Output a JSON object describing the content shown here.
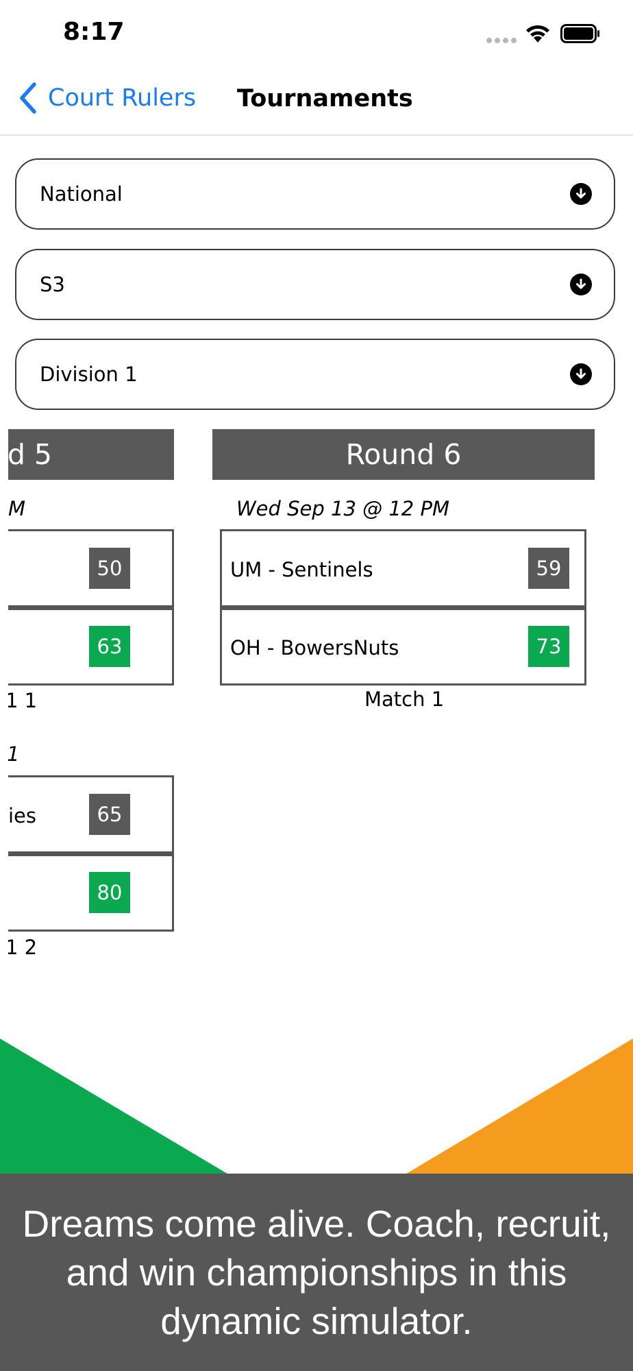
{
  "status_bar": {
    "time": "8:17"
  },
  "nav": {
    "back_label": "Court Rulers",
    "title": "Tournaments"
  },
  "selectors": [
    {
      "label": "National"
    },
    {
      "label": "S3"
    },
    {
      "label": "Division 1"
    }
  ],
  "bracket": {
    "round5": {
      "title": "d 5",
      "matches": [
        {
          "date": "M",
          "teams": [
            {
              "name": "",
              "score": "50",
              "winner": false
            },
            {
              "name": "",
              "score": "63",
              "winner": true
            }
          ],
          "label": "1 1"
        },
        {
          "date": "1",
          "teams": [
            {
              "name": "ies",
              "score": "65",
              "winner": false
            },
            {
              "name": "",
              "score": "80",
              "winner": true
            }
          ],
          "label": "1 2"
        }
      ]
    },
    "round6": {
      "title": "Round 6",
      "matches": [
        {
          "date": "Wed Sep 13 @ 12 PM",
          "teams": [
            {
              "name": "UM - Sentinels",
              "score": "59",
              "winner": false
            },
            {
              "name": "OH - BowersNuts",
              "score": "73",
              "winner": true
            }
          ],
          "label": "Match 1"
        }
      ]
    }
  },
  "banner": {
    "text": "Dreams come alive. Coach, recruit, and win championships in this dynamic simulator."
  },
  "colors": {
    "accent": "#1a7cf5",
    "win": "#0aa84f",
    "loss": "#595959",
    "green_shape": "#0aa84f",
    "orange_shape": "#f59c1f"
  },
  "icons": {
    "back": "chevron-left-icon",
    "dropdown": "arrow-down-circle-icon",
    "wifi": "wifi-icon",
    "battery": "battery-icon",
    "signal": "signal-icon"
  }
}
